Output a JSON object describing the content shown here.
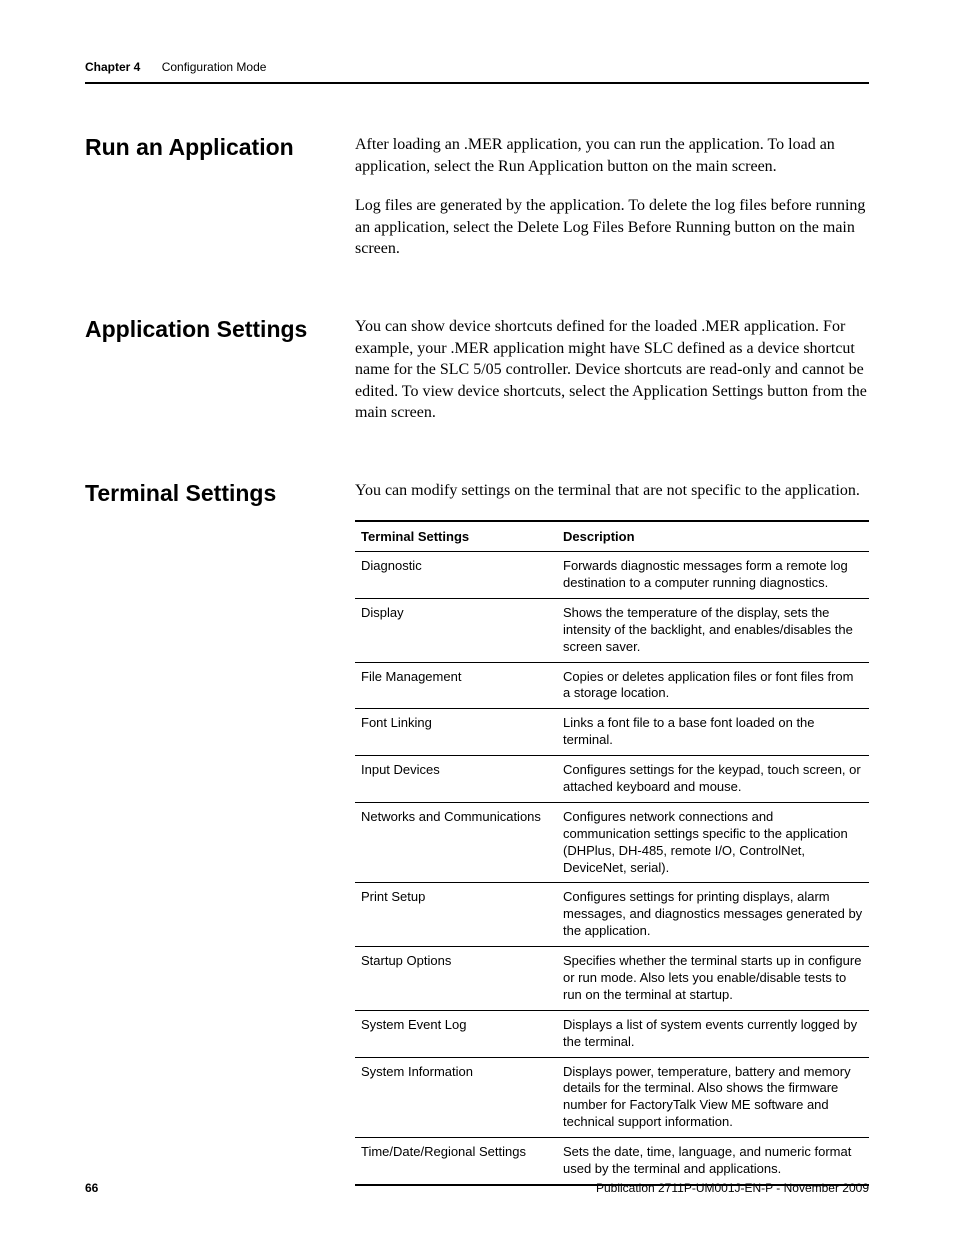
{
  "header": {
    "chapter": "Chapter 4",
    "title": "Configuration Mode"
  },
  "sections": {
    "run_app": {
      "heading": "Run an Application",
      "p1": "After loading an .MER application, you can run the application. To load an application, select the Run Application button on the main screen.",
      "p2": "Log files are generated by the application. To delete the log files before running an application, select the Delete Log Files Before Running button on the main screen."
    },
    "app_settings": {
      "heading": "Application Settings",
      "p1": "You can show device shortcuts defined for the loaded .MER application. For example, your .MER application might have SLC defined as a device shortcut name for the SLC 5/05 controller. Device shortcuts are read-only and cannot be edited. To view device shortcuts, select the Application Settings button from the main screen."
    },
    "term_settings": {
      "heading": "Terminal Settings",
      "p1": "You can modify settings on the terminal that are not specific to the application.",
      "table": {
        "col1": "Terminal Settings",
        "col2": "Description",
        "rows": [
          {
            "name": "Diagnostic",
            "desc": "Forwards diagnostic messages form a remote log destination to a computer running diagnostics."
          },
          {
            "name": "Display",
            "desc": "Shows the temperature of the display, sets the intensity of the backlight, and enables/disables the screen saver."
          },
          {
            "name": "File Management",
            "desc": "Copies or deletes application files or font files from a storage location."
          },
          {
            "name": "Font Linking",
            "desc": "Links a font file to a base font loaded on the terminal."
          },
          {
            "name": "Input Devices",
            "desc": "Configures settings for the keypad, touch screen, or attached keyboard and mouse."
          },
          {
            "name": "Networks and Communications",
            "desc": "Configures network connections and communication settings specific to the application (DHPlus, DH-485, remote I/O, ControlNet, DeviceNet, serial)."
          },
          {
            "name": "Print Setup",
            "desc": "Configures settings for printing displays, alarm messages, and diagnostics messages generated by the application."
          },
          {
            "name": "Startup Options",
            "desc": "Specifies whether the terminal starts up in configure or run mode. Also lets you enable/disable tests to run on the terminal at startup."
          },
          {
            "name": "System Event Log",
            "desc": "Displays a list of system events currently logged by the terminal."
          },
          {
            "name": "System Information",
            "desc": "Displays power, temperature, battery and memory details for the terminal. Also shows the firmware number for FactoryTalk View ME software and technical support information."
          },
          {
            "name": "Time/Date/Regional Settings",
            "desc": "Sets the date, time, language, and numeric format used by the terminal and applications."
          }
        ]
      }
    }
  },
  "footer": {
    "page": "66",
    "pub": "Publication 2711P-UM001J-EN-P - November 2009"
  }
}
